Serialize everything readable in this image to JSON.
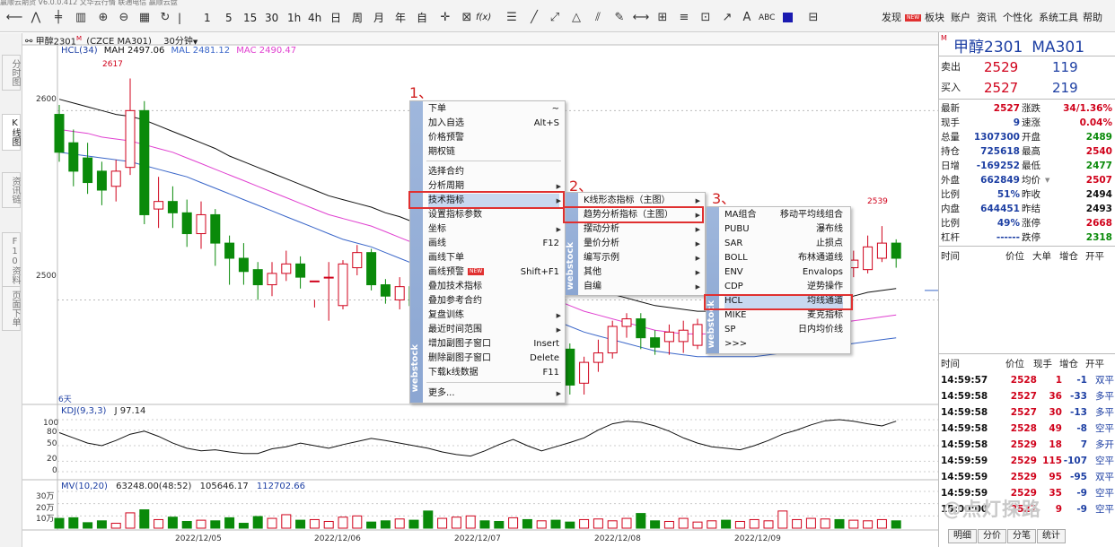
{
  "toolbar": {
    "top_strip": "赢顺云期货  V6.0.0.412  文华云行情  联通电信  赢顺云盘",
    "icons": [
      "back-icon",
      "line-chart-icon",
      "kline-icon",
      "bar-chart-icon",
      "zoom-in-icon",
      "zoom-out-icon",
      "grid-icon",
      "refresh-icon"
    ],
    "periods": [
      "1",
      "5",
      "15",
      "30",
      "1h",
      "4h",
      "日",
      "周",
      "月",
      "年",
      "自"
    ],
    "fx_label": "f(x)",
    "abc_label": "ABC",
    "right_menu": {
      "discover": "发现",
      "discover_badge": "NEW",
      "sector": "板块",
      "account": "账户",
      "news": "资讯",
      "personalize": "个性化",
      "system_tools": "系统工具",
      "help": "帮助"
    }
  },
  "left_tabs": [
    "分时图",
    "K线图",
    "资讯链",
    "F10资料",
    "页面下单"
  ],
  "chart_header": {
    "instrument": "甲醇2301",
    "badge": "M",
    "code": "(CZCE MA301)",
    "period": "30分钟",
    "period_arrow": "▼"
  },
  "main_indicator": {
    "name": "HCL(34)",
    "mah": "MAH 2497.06",
    "mal": "MAL 2481.12",
    "mac": "MAC 2490.47"
  },
  "price_axis": {
    "labels": [
      "2600",
      "2500"
    ]
  },
  "annotations": {
    "high_label": "2617",
    "right_high_label": "2539",
    "days_label": "6天"
  },
  "kdj": {
    "name": "KDJ(9,3,3)",
    "j": "J 97.14",
    "axis": [
      "100",
      "80",
      "50",
      "20",
      "0"
    ]
  },
  "volume": {
    "name": "MV(10,20)",
    "v1": "63248.00(48:52)",
    "v2": "105646.17",
    "v3": "112702.66",
    "axis": [
      "30万",
      "20万",
      "10万"
    ]
  },
  "dates": [
    "2022/12/05",
    "2022/12/06",
    "2022/12/07",
    "2022/12/08",
    "2022/12/09"
  ],
  "context_menu": {
    "logo": "webstock",
    "items": [
      {
        "label": "下单",
        "shortcut": "~"
      },
      {
        "label": "加入自选",
        "shortcut": "Alt+S"
      },
      {
        "label": "价格预警",
        "shortcut": ""
      },
      {
        "label": "期权链",
        "shortcut": ""
      },
      {
        "label": "选择合约",
        "shortcut": ""
      },
      {
        "label": "分析周期",
        "shortcut": "▶"
      },
      {
        "label": "技术指标",
        "shortcut": "▶"
      },
      {
        "label": "设置指标参数",
        "shortcut": ""
      },
      {
        "label": "坐标",
        "shortcut": "▶"
      },
      {
        "label": "画线",
        "shortcut": "F12"
      },
      {
        "label": "画线下单",
        "shortcut": ""
      },
      {
        "label": "画线预警",
        "shortcut": "Shift+F1",
        "badge": "NEW"
      },
      {
        "label": "叠加技术指标",
        "shortcut": ""
      },
      {
        "label": "叠加参考合约",
        "shortcut": ""
      },
      {
        "label": "复盘训练",
        "shortcut": "▶"
      },
      {
        "label": "最近时间范围",
        "shortcut": "▶"
      },
      {
        "label": "增加副图子窗口",
        "shortcut": "Insert"
      },
      {
        "label": "删除副图子窗口",
        "shortcut": "Delete"
      },
      {
        "label": "下载k线数据",
        "shortcut": "F11"
      },
      {
        "label": "更多...",
        "shortcut": "▶"
      }
    ]
  },
  "submenu1": {
    "logo": "webstock",
    "items": [
      {
        "label": "K线形态指标（主图）",
        "shortcut": "▶"
      },
      {
        "label": "趋势分析指标（主图）",
        "shortcut": "▶"
      },
      {
        "label": "摆动分析",
        "shortcut": "▶"
      },
      {
        "label": "量价分析",
        "shortcut": "▶"
      },
      {
        "label": "编写示例",
        "shortcut": "▶"
      },
      {
        "label": "其他",
        "shortcut": "▶"
      },
      {
        "label": "自编",
        "shortcut": "▶"
      }
    ]
  },
  "submenu2": {
    "logo": "webstock",
    "items": [
      {
        "code": "MA组合",
        "name": "移动平均线组合"
      },
      {
        "code": "PUBU",
        "name": "瀑布线"
      },
      {
        "code": "SAR",
        "name": "止损点"
      },
      {
        "code": "BOLL",
        "name": "布林通道线"
      },
      {
        "code": "ENV",
        "name": "Envalops"
      },
      {
        "code": "CDP",
        "name": "逆势操作"
      },
      {
        "code": "HCL",
        "name": "均线通道"
      },
      {
        "code": "MIKE",
        "name": "麦克指标"
      },
      {
        "code": "SP",
        "name": "日内均价线"
      },
      {
        "code": ">>>",
        "name": ""
      }
    ]
  },
  "step_labels": [
    "1、",
    "2、",
    "3、"
  ],
  "quote_panel": {
    "badge": "M",
    "name": "甲醇2301",
    "code": "MA301",
    "sell": {
      "label": "卖出",
      "price": "2529",
      "vol": "119"
    },
    "buy": {
      "label": "买入",
      "price": "2527",
      "vol": "219"
    },
    "stats": [
      {
        "l1": "最新",
        "v1": "2527",
        "c1": "red",
        "l2": "涨跌",
        "v2": "34/1.36%",
        "c2": "red"
      },
      {
        "l1": "现手",
        "v1": "9",
        "c1": "blue",
        "l2": "速涨",
        "v2": "0.04%",
        "c2": "red"
      },
      {
        "l1": "总量",
        "v1": "1307300",
        "c1": "blue",
        "l2": "开盘",
        "v2": "2489",
        "c2": "green"
      },
      {
        "l1": "持仓",
        "v1": "725618",
        "c1": "blue",
        "l2": "最高",
        "v2": "2540",
        "c2": "red"
      },
      {
        "l1": "日增",
        "v1": "-169252",
        "c1": "blue",
        "l2": "最低",
        "v2": "2477",
        "c2": "green"
      },
      {
        "l1": "外盘",
        "v1": "662849",
        "c1": "blue",
        "l2": "均价",
        "v2": "2507",
        "c2": "red"
      },
      {
        "l1": "比例",
        "v1": "51%",
        "c1": "blue",
        "l2": "昨收",
        "v2": "2494",
        "c2": "dark"
      },
      {
        "l1": "内盘",
        "v1": "644451",
        "c1": "blue",
        "l2": "昨结",
        "v2": "2493",
        "c2": "dark"
      },
      {
        "l1": "比例",
        "v1": "49%",
        "c1": "blue",
        "l2": "涨停",
        "v2": "2668",
        "c2": "red"
      },
      {
        "l1": "杠杆",
        "v1": "------",
        "c1": "blue",
        "l2": "跌停",
        "v2": "2318",
        "c2": "green"
      }
    ],
    "avg_arrow": "▼",
    "header1": {
      "time": "时间",
      "price": "价位",
      "big": "大单",
      "inc": "增仓",
      "open": "开平"
    },
    "header2": {
      "time": "时间",
      "price": "价位",
      "hand": "现手",
      "inc": "增仓",
      "open": "开平"
    },
    "ticks": [
      {
        "t": "14:59:57",
        "p": "2528",
        "h": "1",
        "i": "-1",
        "o": "双平"
      },
      {
        "t": "14:59:58",
        "p": "2527",
        "h": "36",
        "i": "-33",
        "o": "多平"
      },
      {
        "t": "14:59:58",
        "p": "2527",
        "h": "30",
        "i": "-13",
        "o": "多平"
      },
      {
        "t": "14:59:58",
        "p": "2528",
        "h": "49",
        "i": "-8",
        "o": "空平"
      },
      {
        "t": "14:59:58",
        "p": "2529",
        "h": "18",
        "i": "7",
        "o": "多开"
      },
      {
        "t": "14:59:59",
        "p": "2529",
        "h": "115",
        "i": "-107",
        "o": "空平"
      },
      {
        "t": "14:59:59",
        "p": "2529",
        "h": "95",
        "i": "-95",
        "o": "双平"
      },
      {
        "t": "14:59:59",
        "p": "2529",
        "h": "35",
        "i": "-9",
        "o": "空平"
      },
      {
        "t": "15:00:00",
        "p": "2527",
        "h": "9",
        "i": "-9",
        "o": "空平"
      }
    ],
    "bottom_tabs": [
      "明细",
      "分价",
      "分笔",
      "统计"
    ]
  },
  "watermark": "@点灯探路",
  "colors": {
    "up": "#d0021b",
    "down": "#0a8a0a",
    "mah": "#111111",
    "mal": "#3a66c9",
    "mac": "#e040d0",
    "highlight": "#e03030"
  },
  "chart_data": {
    "type": "candlestick",
    "ylim": [
      2450,
      2630
    ],
    "candles": [
      {
        "o": 2598,
        "c": 2578,
        "h": 2603,
        "l": 2573
      },
      {
        "o": 2583,
        "c": 2568,
        "h": 2590,
        "l": 2560
      },
      {
        "o": 2575,
        "c": 2562,
        "h": 2583,
        "l": 2556
      },
      {
        "o": 2568,
        "c": 2558,
        "h": 2573,
        "l": 2550
      },
      {
        "o": 2560,
        "c": 2568,
        "h": 2574,
        "l": 2552
      },
      {
        "o": 2570,
        "c": 2600,
        "h": 2617,
        "l": 2566
      },
      {
        "o": 2600,
        "c": 2545,
        "h": 2605,
        "l": 2540
      },
      {
        "o": 2548,
        "c": 2552,
        "h": 2565,
        "l": 2538
      },
      {
        "o": 2552,
        "c": 2546,
        "h": 2560,
        "l": 2538
      },
      {
        "o": 2546,
        "c": 2535,
        "h": 2553,
        "l": 2528
      },
      {
        "o": 2535,
        "c": 2545,
        "h": 2552,
        "l": 2527
      },
      {
        "o": 2545,
        "c": 2530,
        "h": 2548,
        "l": 2518
      },
      {
        "o": 2530,
        "c": 2522,
        "h": 2534,
        "l": 2508
      },
      {
        "o": 2522,
        "c": 2515,
        "h": 2530,
        "l": 2508
      },
      {
        "o": 2516,
        "c": 2508,
        "h": 2520,
        "l": 2500
      },
      {
        "o": 2508,
        "c": 2514,
        "h": 2520,
        "l": 2502
      },
      {
        "o": 2514,
        "c": 2519,
        "h": 2526,
        "l": 2510
      },
      {
        "o": 2519,
        "c": 2512,
        "h": 2523,
        "l": 2506
      },
      {
        "o": 2510,
        "c": 2510,
        "h": 2500,
        "l": 2496
      },
      {
        "o": 2512,
        "c": 2512,
        "h": 2520,
        "l": 2489
      },
      {
        "o": 2497,
        "c": 2519,
        "h": 2521,
        "l": 2495
      },
      {
        "o": 2517,
        "c": 2525,
        "h": 2529,
        "l": 2513
      },
      {
        "o": 2525,
        "c": 2508,
        "h": 2527,
        "l": 2505
      },
      {
        "o": 2508,
        "c": 2502,
        "h": 2511,
        "l": 2498
      },
      {
        "o": 2500,
        "c": 2507,
        "h": 2512,
        "l": 2495
      },
      {
        "o": 2507,
        "c": 2497,
        "h": 2510,
        "l": 2490
      },
      {
        "o": 2497,
        "c": 2482,
        "h": 2500,
        "l": 2478
      },
      {
        "o": 2482,
        "c": 2490,
        "h": 2497,
        "l": 2479
      },
      {
        "o": 2490,
        "c": 2495,
        "h": 2500,
        "l": 2485
      },
      {
        "o": 2495,
        "c": 2500,
        "h": 2503,
        "l": 2490
      },
      {
        "o": 2500,
        "c": 2490,
        "h": 2503,
        "l": 2486
      },
      {
        "o": 2490,
        "c": 2486,
        "h": 2495,
        "l": 2481
      },
      {
        "o": 2486,
        "c": 2490,
        "h": 2497,
        "l": 2482
      },
      {
        "o": 2490,
        "c": 2484,
        "h": 2494,
        "l": 2480
      },
      {
        "o": 2490,
        "c": 2494,
        "h": 2497,
        "l": 2486
      },
      {
        "o": 2493,
        "c": 2473,
        "h": 2496,
        "l": 2468
      },
      {
        "o": 2474,
        "c": 2455,
        "h": 2477,
        "l": 2450
      },
      {
        "o": 2456,
        "c": 2467,
        "h": 2470,
        "l": 2450
      },
      {
        "o": 2467,
        "c": 2472,
        "h": 2479,
        "l": 2462
      },
      {
        "o": 2472,
        "c": 2486,
        "h": 2489,
        "l": 2469
      },
      {
        "o": 2486,
        "c": 2490,
        "h": 2493,
        "l": 2480
      },
      {
        "o": 2490,
        "c": 2480,
        "h": 2493,
        "l": 2474
      },
      {
        "o": 2480,
        "c": 2475,
        "h": 2484,
        "l": 2471
      },
      {
        "o": 2478,
        "c": 2483,
        "h": 2487,
        "l": 2471
      },
      {
        "o": 2478,
        "c": 2484,
        "h": 2489,
        "l": 2472
      },
      {
        "o": 2476,
        "c": 2487,
        "h": 2490,
        "l": 2474
      },
      {
        "o": 2487,
        "c": 2492,
        "h": 2496,
        "l": 2480
      },
      {
        "o": 2492,
        "c": 2490,
        "h": 2500,
        "l": 2486
      },
      {
        "o": 2490,
        "c": 2497,
        "h": 2501,
        "l": 2484
      },
      {
        "o": 2497,
        "c": 2498,
        "h": 2502,
        "l": 2495
      },
      {
        "o": 2498,
        "c": 2500,
        "h": 2505,
        "l": 2496
      },
      {
        "o": 2500,
        "c": 2502,
        "h": 2510,
        "l": 2497
      },
      {
        "o": 2502,
        "c": 2507,
        "h": 2512,
        "l": 2498
      },
      {
        "o": 2507,
        "c": 2510,
        "h": 2516,
        "l": 2503
      },
      {
        "o": 2512,
        "c": 2521,
        "h": 2524,
        "l": 2506
      },
      {
        "o": 2521,
        "c": 2519,
        "h": 2527,
        "l": 2515
      },
      {
        "o": 2517,
        "c": 2521,
        "h": 2526,
        "l": 2512
      },
      {
        "o": 2516,
        "c": 2528,
        "h": 2534,
        "l": 2514
      },
      {
        "o": 2522,
        "c": 2530,
        "h": 2539,
        "l": 2520
      },
      {
        "o": 2530,
        "c": 2522,
        "h": 2532,
        "l": 2517
      }
    ],
    "mah": [
      2606,
      2604,
      2602,
      2600,
      2598,
      2597,
      2595,
      2592,
      2589,
      2586,
      2583,
      2580,
      2576,
      2573,
      2570,
      2567,
      2564,
      2561,
      2558,
      2555,
      2553,
      2551,
      2549,
      2546,
      2544,
      2541,
      2538,
      2535,
      2532,
      2530,
      2527,
      2524,
      2521,
      2518,
      2515,
      2512,
      2509,
      2507,
      2505,
      2503,
      2501,
      2499,
      2497,
      2496,
      2495,
      2494,
      2494,
      2494,
      2494,
      2494,
      2495,
      2495,
      2496,
      2497,
      2499,
      2500,
      2502,
      2504,
      2505,
      2506
    ],
    "mac": [
      2590,
      2589,
      2588,
      2586,
      2585,
      2584,
      2582,
      2580,
      2578,
      2575,
      2572,
      2569,
      2566,
      2563,
      2560,
      2557,
      2554,
      2551,
      2548,
      2545,
      2543,
      2541,
      2539,
      2536,
      2533,
      2530,
      2527,
      2524,
      2521,
      2518,
      2515,
      2512,
      2509,
      2506,
      2503,
      2500,
      2497,
      2494,
      2492,
      2490,
      2488,
      2486,
      2484,
      2483,
      2482,
      2482,
      2482,
      2482,
      2482,
      2483,
      2483,
      2484,
      2485,
      2486,
      2487,
      2488,
      2489,
      2490,
      2491,
      2492
    ],
    "mal": [
      2578,
      2577,
      2576,
      2575,
      2574,
      2573,
      2571,
      2569,
      2567,
      2565,
      2562,
      2559,
      2556,
      2553,
      2550,
      2547,
      2544,
      2541,
      2538,
      2535,
      2532,
      2530,
      2528,
      2525,
      2522,
      2519,
      2516,
      2513,
      2510,
      2507,
      2504,
      2501,
      2498,
      2495,
      2492,
      2489,
      2486,
      2483,
      2481,
      2479,
      2477,
      2475,
      2473,
      2472,
      2471,
      2470,
      2470,
      2470,
      2470,
      2470,
      2471,
      2472,
      2473,
      2474,
      2475,
      2476,
      2477,
      2478,
      2479,
      2480
    ],
    "kdj_ylim": [
      0,
      100
    ],
    "kdj_j": [
      75,
      65,
      55,
      50,
      60,
      72,
      78,
      68,
      55,
      45,
      40,
      42,
      38,
      35,
      35,
      44,
      48,
      55,
      50,
      45,
      52,
      58,
      64,
      60,
      55,
      50,
      45,
      38,
      33,
      30,
      40,
      52,
      62,
      50,
      40,
      48,
      56,
      65,
      80,
      92,
      97,
      95,
      88,
      78,
      65,
      55,
      48,
      45,
      42,
      50,
      60,
      72,
      80,
      90,
      98,
      100,
      97,
      92,
      88,
      97
    ],
    "vol_ylim": [
      0,
      300000
    ],
    "volumes": [
      80000,
      85000,
      45000,
      60000,
      40000,
      125000,
      150000,
      70000,
      90000,
      55000,
      65000,
      60000,
      85000,
      40000,
      95000,
      80000,
      110000,
      65000,
      70000,
      55000,
      90000,
      100000,
      50000,
      60000,
      75000,
      65000,
      140000,
      80000,
      90000,
      100000,
      60000,
      55000,
      85000,
      70000,
      60000,
      65000,
      50000,
      70000,
      75000,
      60000,
      80000,
      120000,
      60000,
      55000,
      80000,
      50000,
      60000,
      65000,
      55000,
      70000,
      60000,
      140000,
      70000,
      80000,
      75000,
      70000,
      65000,
      60000,
      70000,
      60000
    ]
  }
}
